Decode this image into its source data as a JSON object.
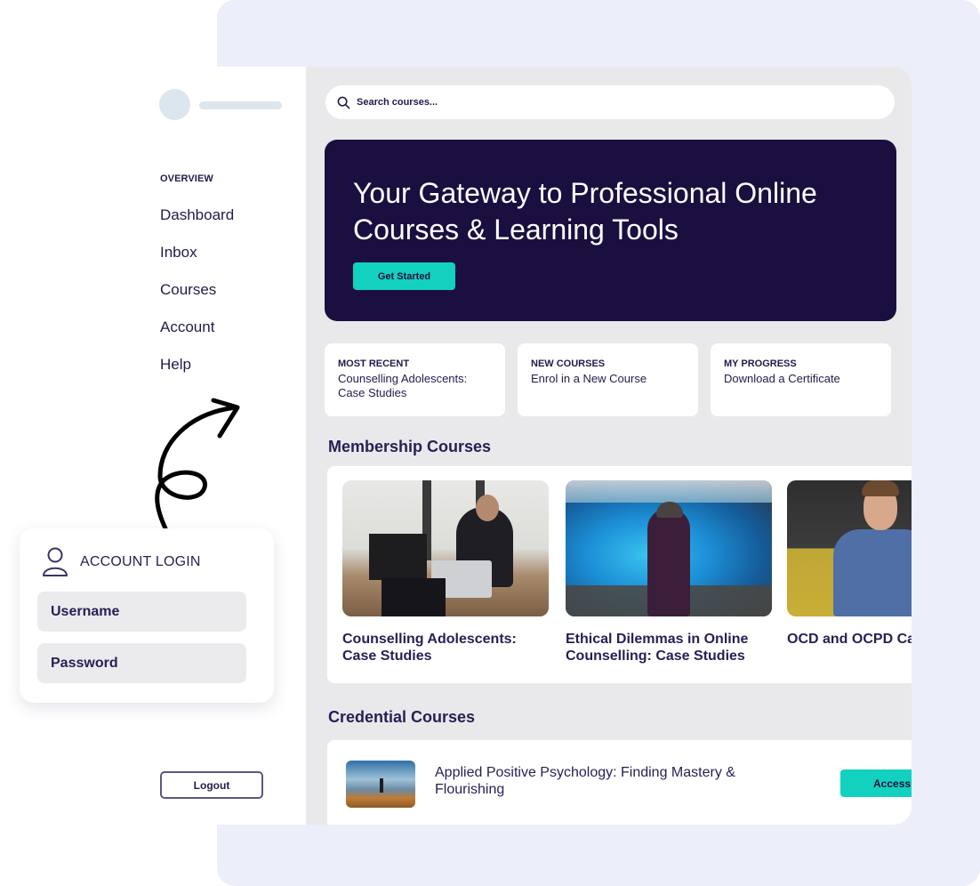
{
  "colors": {
    "background_frame": "#eceefa",
    "hero_bg": "#1b0f40",
    "accent": "#13d1bf",
    "text_primary": "#241a4a",
    "panel_bg": "#e9e9eb"
  },
  "sidebar": {
    "section_heading": "OVERVIEW",
    "items": [
      {
        "label": "Dashboard"
      },
      {
        "label": "Inbox"
      },
      {
        "label": "Courses"
      },
      {
        "label": "Account"
      },
      {
        "label": "Help"
      }
    ],
    "logout_label": "Logout"
  },
  "search": {
    "icon": "search-icon",
    "placeholder": "Search courses..."
  },
  "hero": {
    "title": "Your Gateway to Professional Online Courses & Learning Tools",
    "cta_label": "Get Started"
  },
  "quick_links": [
    {
      "label": "MOST RECENT",
      "text": "Counselling Adolescents: Case Studies"
    },
    {
      "label": "NEW COURSES",
      "text": "Enrol in a New Course"
    },
    {
      "label": "MY PROGRESS",
      "text": "Download a Certificate"
    }
  ],
  "membership": {
    "title": "Membership Courses",
    "courses": [
      {
        "title": "Counselling Adolescents: Case Studies",
        "image": "office-laptop-photo"
      },
      {
        "title": "Ethical Dilemmas in Online Counselling: Case Studies",
        "image": "blue-smoke-photo"
      },
      {
        "title": "OCD and OCPD Case Studies",
        "image": "man-writing-photo"
      }
    ]
  },
  "credential": {
    "title": "Credential Courses",
    "courses": [
      {
        "title": "Applied Positive Psychology: Finding Mastery & Flourishing",
        "image": "mountain-hiker-photo",
        "button_label": "Access"
      }
    ]
  },
  "login": {
    "title": "ACCOUNT LOGIN",
    "icon": "user-icon",
    "username_placeholder": "Username",
    "password_placeholder": "Password"
  }
}
